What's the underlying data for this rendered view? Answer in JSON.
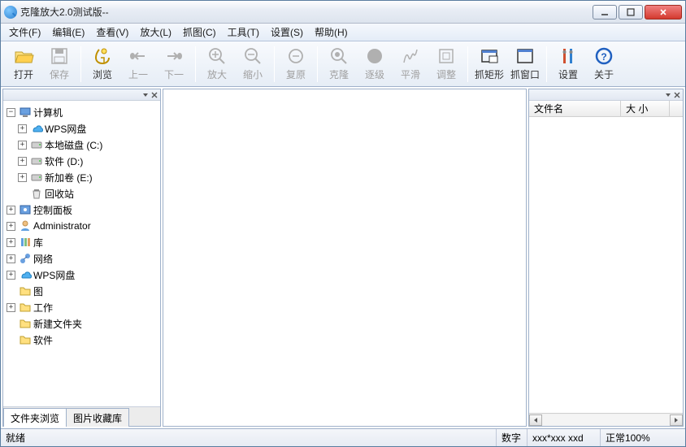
{
  "window": {
    "title": "克隆放大2.0测试版--"
  },
  "menus": [
    {
      "label": "文件(F)"
    },
    {
      "label": "编辑(E)"
    },
    {
      "label": "查看(V)"
    },
    {
      "label": "放大(L)"
    },
    {
      "label": "抓图(C)"
    },
    {
      "label": "工具(T)"
    },
    {
      "label": "设置(S)"
    },
    {
      "label": "帮助(H)"
    }
  ],
  "toolbar": [
    {
      "label": "打开",
      "icon": "folder-open",
      "enabled": true
    },
    {
      "label": "保存",
      "icon": "save",
      "enabled": false
    },
    {
      "sep": true
    },
    {
      "label": "浏览",
      "icon": "browse",
      "enabled": true
    },
    {
      "label": "上一",
      "icon": "hand-left",
      "enabled": false
    },
    {
      "label": "下一",
      "icon": "hand-right",
      "enabled": false
    },
    {
      "sep": true
    },
    {
      "label": "放大",
      "icon": "zoom-in",
      "enabled": false
    },
    {
      "label": "缩小",
      "icon": "zoom-out",
      "enabled": false
    },
    {
      "sep": true
    },
    {
      "label": "复原",
      "icon": "restore",
      "enabled": false
    },
    {
      "sep": true
    },
    {
      "label": "克隆",
      "icon": "clone",
      "enabled": false
    },
    {
      "label": "逐级",
      "icon": "stepwise",
      "enabled": false
    },
    {
      "label": "平滑",
      "icon": "smooth",
      "enabled": false
    },
    {
      "label": "调整",
      "icon": "adjust",
      "enabled": false
    },
    {
      "sep": true
    },
    {
      "label": "抓矩形",
      "icon": "capture-rect",
      "enabled": true
    },
    {
      "label": "抓窗口",
      "icon": "capture-win",
      "enabled": true
    },
    {
      "sep": true
    },
    {
      "label": "设置",
      "icon": "settings",
      "enabled": true
    },
    {
      "label": "关于",
      "icon": "about",
      "enabled": true
    }
  ],
  "tree": [
    {
      "lvl": 0,
      "exp": "minus",
      "icon": "computer",
      "label": "计算机"
    },
    {
      "lvl": 1,
      "exp": "plus",
      "icon": "cloud",
      "label": "WPS网盘"
    },
    {
      "lvl": 1,
      "exp": "plus",
      "icon": "drive",
      "label": "本地磁盘 (C:)"
    },
    {
      "lvl": 1,
      "exp": "plus",
      "icon": "drive",
      "label": "软件 (D:)"
    },
    {
      "lvl": 1,
      "exp": "plus",
      "icon": "drive",
      "label": "新加卷 (E:)"
    },
    {
      "lvl": 1,
      "exp": "none",
      "icon": "recycle",
      "label": "回收站"
    },
    {
      "lvl": 0,
      "exp": "plus",
      "icon": "control",
      "label": "控制面板"
    },
    {
      "lvl": 0,
      "exp": "plus",
      "icon": "user",
      "label": "Administrator"
    },
    {
      "lvl": 0,
      "exp": "plus",
      "icon": "library",
      "label": "库"
    },
    {
      "lvl": 0,
      "exp": "plus",
      "icon": "network",
      "label": "网络"
    },
    {
      "lvl": 0,
      "exp": "plus",
      "icon": "cloud",
      "label": "WPS网盘"
    },
    {
      "lvl": 0,
      "exp": "none",
      "icon": "folder",
      "label": "图"
    },
    {
      "lvl": 0,
      "exp": "plus",
      "icon": "folder",
      "label": "工作"
    },
    {
      "lvl": 0,
      "exp": "none",
      "icon": "folder",
      "label": "新建文件夹"
    },
    {
      "lvl": 0,
      "exp": "none",
      "icon": "folder",
      "label": "软件"
    }
  ],
  "left_tabs": [
    {
      "label": "文件夹浏览",
      "active": true
    },
    {
      "label": "图片收藏库",
      "active": false
    }
  ],
  "right_columns": [
    {
      "label": "文件名",
      "width": 113
    },
    {
      "label": "大 小",
      "width": 60
    }
  ],
  "status": {
    "ready": "就绪",
    "dim_label": "数字",
    "dim_value": "xxx*xxx xxd",
    "zoom": "正常100%"
  }
}
